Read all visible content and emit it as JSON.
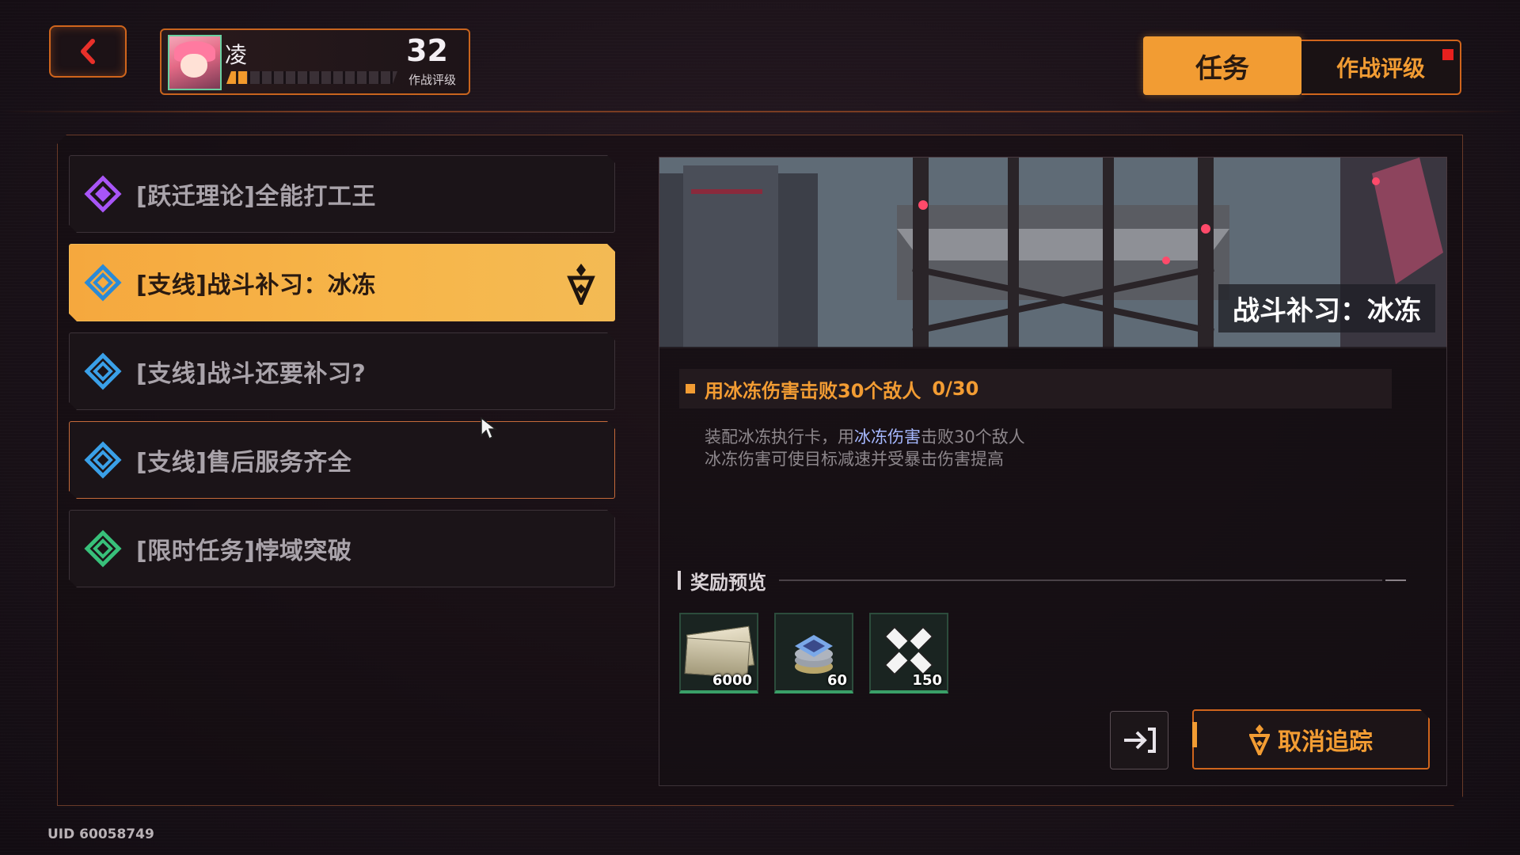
{
  "player": {
    "name": "凌",
    "level": "32",
    "level_caption": "作战评级",
    "xp_fraction": 0.12
  },
  "tabs": [
    {
      "label": "任务",
      "active": true
    },
    {
      "label": "作战评级",
      "active": false,
      "has_notification": true
    }
  ],
  "quests": [
    {
      "label": "[跃迁理论]全能打工王",
      "icon": "purple-diamond-icon",
      "color": "#a855f7"
    },
    {
      "label": "[支线]战斗补习：冰冻",
      "icon": "blue-diamond-icon",
      "color": "#2a8ad6",
      "selected": true,
      "tracked": true
    },
    {
      "label": "[支线]战斗还要补习?",
      "icon": "blue-diamond-icon",
      "color": "#3aa0e8"
    },
    {
      "label": "[支线]售后服务齐全",
      "icon": "blue-diamond-icon",
      "color": "#3aa0e8"
    },
    {
      "label": "[限时任务]悖域突破",
      "icon": "green-diamond-icon",
      "color": "#38c07a"
    }
  ],
  "detail": {
    "banner_title": "战斗补习：冰冻",
    "objective": "用冰冻伤害击败30个敌人",
    "progress": "0/30",
    "description_line1_a": "装配冰冻执行卡，用",
    "description_line1_highlight": "冰冻伤害",
    "description_line1_b": "击败30个敌人",
    "description_line2": "冰冻伤害可使目标减速并受暴击伤害提高",
    "rewards_title": "奖励预览",
    "rewards": [
      {
        "icon": "currency-notes-icon",
        "count": "6000"
      },
      {
        "icon": "chip-stack-icon",
        "count": "60"
      },
      {
        "icon": "cross-badge-icon",
        "count": "150"
      }
    ],
    "cancel_label": "取消追踪"
  },
  "footer": {
    "uid": "UID 60058749"
  },
  "colors": {
    "accent": "#f29c33",
    "frame": "#d0651c",
    "selected_bg": "#f5a83e"
  }
}
